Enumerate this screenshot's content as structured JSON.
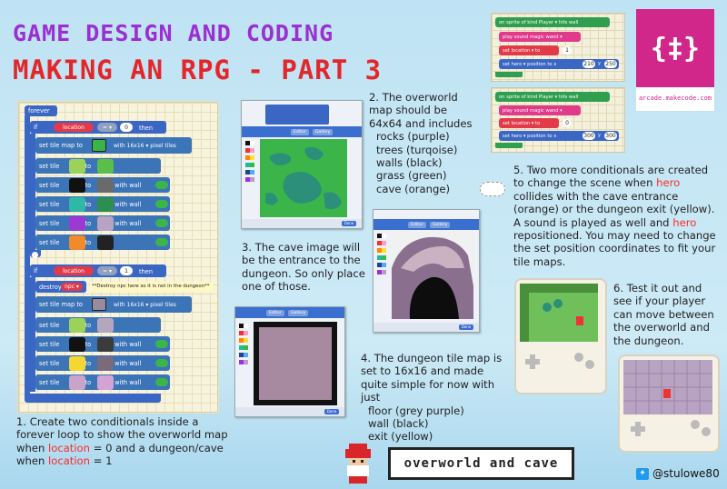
{
  "title": {
    "line1": "GAME DESIGN AND CODING",
    "line2": "MAKING AN RPG - PART 3"
  },
  "colors": {
    "title1": "#9b2fd3",
    "title2": "#e3262a",
    "highlight": "#ff2a2a",
    "background": "#c7e6f5"
  },
  "logo": {
    "glyph": "{‡}",
    "url_text": "arcade.makecode.com"
  },
  "steps": {
    "s1": {
      "pre": "1. Create two conditionals inside a forever loop to show the overworld map when ",
      "kw1": "location",
      "mid1": " = 0 and a dungeon/cave when ",
      "kw2": "location",
      "mid2": " = 1"
    },
    "s2": {
      "text": "2. The overworld map should be 64x64 and includes",
      "items": [
        "rocks (purple)",
        "trees (turqoise)",
        "walls (black)",
        "grass (green)",
        "cave (orange)"
      ]
    },
    "s3": {
      "text": "3. The cave image will be the entrance to the dungeon. So only place one of those."
    },
    "s4": {
      "text": "4. The dungeon tile map is set to 16x16 and made quite simple for now with just",
      "items": [
        "floor (grey purple)",
        "wall (black)",
        "exit (yellow)"
      ]
    },
    "s5": {
      "a": "5. Two more conditionals are created to change the scene when ",
      "hero1": "hero",
      "b": " collides with the cave entrance (orange) or the dungeon exit (yellow). A sound is played as well and ",
      "hero2": "hero",
      "c": " repositioned. You may need to change the set position coordinates to fit your tile maps."
    },
    "s6": {
      "text": "6. Test it out and see if your player can move between the overworld and the dungeon."
    }
  },
  "code": {
    "forever": "forever",
    "if": "if",
    "then": "then",
    "location": "location",
    "eq": "= ▾",
    "zero": "0",
    "one": "1",
    "set_tilemap": "set tile map to",
    "with16": "with 16x16 ▾ pixel tiles",
    "set_tile": "set tile",
    "to": "to",
    "with_wall": "with wall",
    "destroy": "destroy",
    "npc": "npc ▾",
    "comment": "**Destroy npc here so it is not in the dungeon**"
  },
  "snippets": {
    "on_sprite": "on sprite of kind Player ▾ hits wall",
    "play_sound": "play sound magic wand ▾",
    "set_location": "set location ▾ to",
    "loc_val_1": "1",
    "loc_val_0": "0",
    "set_hero": "set hero ▾ position to x",
    "xy1": [
      "210",
      "250"
    ],
    "xy2": [
      "300",
      "300"
    ],
    "y_label": "y"
  },
  "editor": {
    "tab_editor": "Editor",
    "tab_gallery": "Gallery",
    "done": "Done"
  },
  "footer": {
    "label": "overworld and cave"
  },
  "twitter": {
    "handle": "@stulowe80"
  }
}
